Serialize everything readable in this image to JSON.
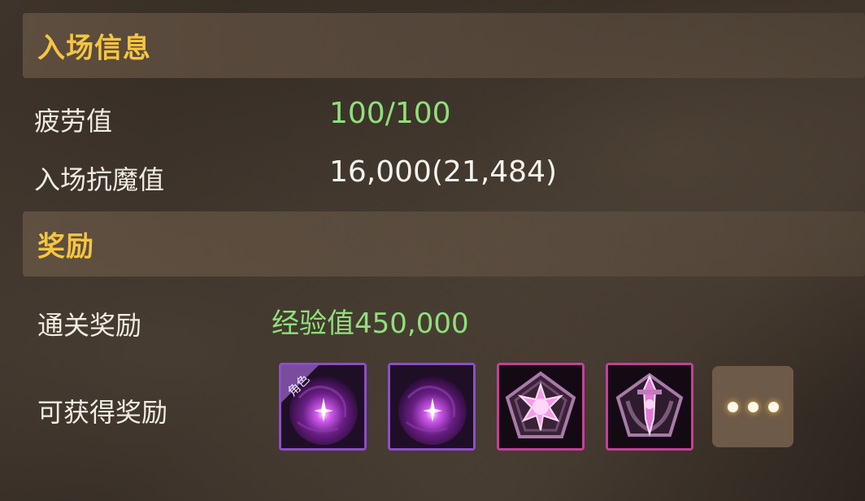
{
  "entry_info": {
    "title": "入场信息",
    "fatigue_label": "疲劳值",
    "fatigue_value": "100/100",
    "resistance_label": "入场抗魔值",
    "resistance_value": "16,000(21,484)"
  },
  "rewards": {
    "title": "奖励",
    "clear_label": "通关奖励",
    "clear_value": "经验值450,000",
    "obtainable_label": "可获得奖励",
    "items": [
      {
        "icon": "purple-orb-icon",
        "tag": "角色",
        "rarity_color": "#8a4fc8"
      },
      {
        "icon": "purple-orb-icon",
        "rarity_color": "#8a4fc8"
      },
      {
        "icon": "pink-star-emblem-icon",
        "rarity_color": "#c2409a"
      },
      {
        "icon": "pink-sword-emblem-icon",
        "rarity_color": "#c2409a"
      }
    ]
  },
  "colors": {
    "header_text": "#f5c542",
    "green_text": "#8fe07a"
  }
}
